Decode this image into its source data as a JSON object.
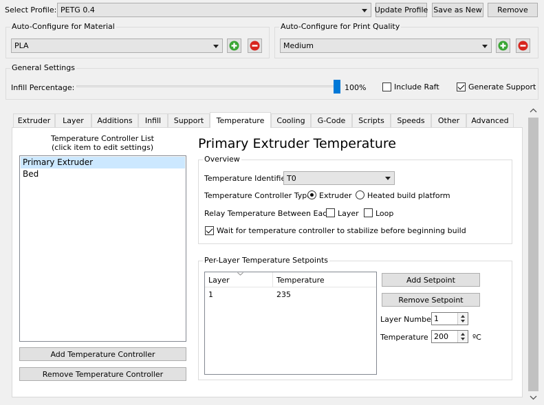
{
  "profile": {
    "label": "Select Profile:",
    "selected": "PETG 0.4",
    "update_label": "Update Profile",
    "save_new_label": "Save as New",
    "remove_label": "Remove"
  },
  "material": {
    "title": "Auto-Configure for Material",
    "selected": "PLA"
  },
  "quality": {
    "title": "Auto-Configure for Print Quality",
    "selected": "Medium"
  },
  "general": {
    "title": "General Settings",
    "infill_label": "Infill Percentage:",
    "infill_value": "100%",
    "infill_fraction": 1.0,
    "include_raft_label": "Include Raft",
    "include_raft_checked": false,
    "generate_support_label": "Generate Support",
    "generate_support_checked": true
  },
  "tabs": [
    "Extruder",
    "Layer",
    "Additions",
    "Infill",
    "Support",
    "Temperature",
    "Cooling",
    "G-Code",
    "Scripts",
    "Speeds",
    "Other",
    "Advanced"
  ],
  "active_tab": "Temperature",
  "controllers": {
    "header_line1": "Temperature Controller List",
    "header_line2": "(click item to edit settings)",
    "items": [
      "Primary Extruder",
      "Bed"
    ],
    "selected_index": 0,
    "add_label": "Add Temperature Controller",
    "remove_label": "Remove Temperature Controller"
  },
  "detail": {
    "title": "Primary Extruder Temperature",
    "overview_title": "Overview",
    "identifier_label": "Temperature Identifier",
    "identifier_value": "T0",
    "type_label": "Temperature Controller Type:",
    "type_extruder_label": "Extruder",
    "type_heated_label": "Heated build platform",
    "type_selected": "Extruder",
    "relay_label": "Relay Temperature Between Each:",
    "relay_layer_label": "Layer",
    "relay_loop_label": "Loop",
    "wait_label": "Wait for temperature controller to stabilize before beginning build",
    "wait_checked": true
  },
  "setpoints": {
    "title": "Per-Layer Temperature Setpoints",
    "columns": [
      "Layer",
      "Temperature"
    ],
    "rows": [
      [
        "1",
        "235"
      ]
    ],
    "add_label": "Add Setpoint",
    "remove_label": "Remove Setpoint",
    "layer_number_label": "Layer Number",
    "layer_number_value": "1",
    "temperature_label": "Temperature",
    "temperature_value": "200",
    "temperature_unit": "ºC"
  },
  "colors": {
    "selection": "#cce8ff",
    "slider_thumb": "#0078d7",
    "add_icon": "#3aa634",
    "remove_icon": "#d7261e"
  }
}
